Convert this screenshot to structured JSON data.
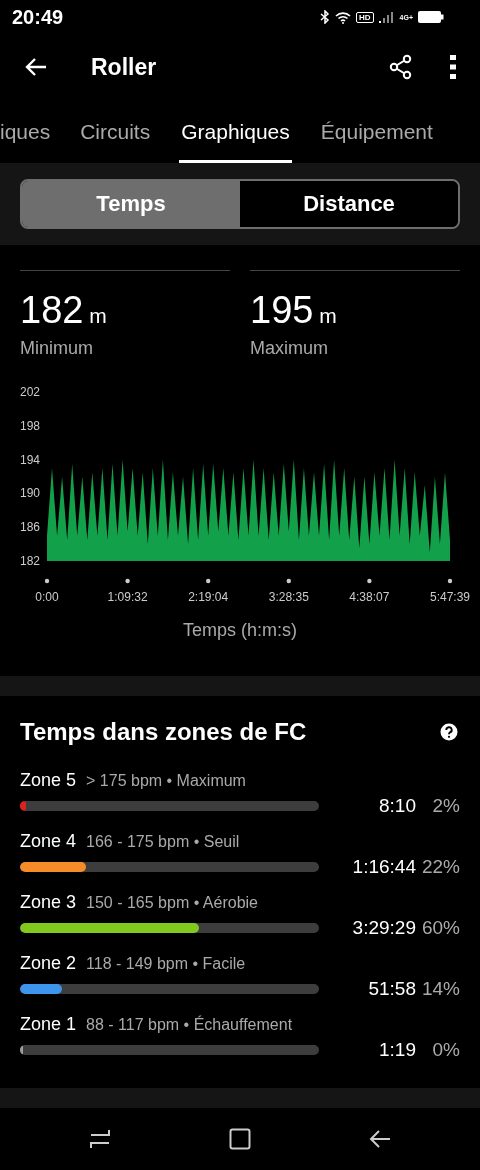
{
  "status_bar": {
    "time": "20:49",
    "hd": "HD",
    "network": "4G+"
  },
  "app_bar": {
    "title": "Roller"
  },
  "tabs": [
    {
      "label": "iques",
      "selected": false
    },
    {
      "label": "Circuits",
      "selected": false
    },
    {
      "label": "Graphiques",
      "selected": true
    },
    {
      "label": "Équipement",
      "selected": false
    }
  ],
  "segmented": [
    {
      "label": "Temps",
      "selected": true
    },
    {
      "label": "Distance",
      "selected": false
    }
  ],
  "stats": [
    {
      "value": "182",
      "unit": "m",
      "label": "Minimum"
    },
    {
      "value": "195",
      "unit": "m",
      "label": "Maximum"
    }
  ],
  "chart": {
    "chart_data": {
      "type": "area",
      "xlabel": "Temps (h:m:s)",
      "x": [
        0,
        261,
        521,
        782,
        1043,
        1304,
        1564,
        1825,
        2086,
        2347,
        2607,
        2868,
        3129,
        3390,
        3650,
        3911,
        4172,
        4433,
        4693,
        4954,
        5215,
        5476,
        5736,
        5997,
        6258,
        6519,
        6779,
        7040,
        7301,
        7561,
        7822,
        8083,
        8344,
        8604,
        8865,
        9126,
        9387,
        9647,
        9908,
        10169,
        10430,
        10690,
        10951,
        11212,
        11473,
        11733,
        11994,
        12255,
        12516,
        12776,
        13037,
        13298,
        13558,
        13819,
        14080,
        14341,
        14601,
        14862,
        15123,
        15384,
        15644,
        15905,
        16166,
        16427,
        16687,
        16948,
        17209,
        17470,
        17730,
        17991,
        18252,
        18513,
        18773,
        19034,
        19295,
        19556,
        19816,
        20077,
        20338,
        20598,
        20859
      ],
      "xlim": [
        0,
        20859
      ],
      "ylim": [
        182,
        202
      ],
      "yticks": [
        182,
        186,
        190,
        194,
        198,
        202
      ],
      "xticks": [
        {
          "value": 0,
          "label": "0:00"
        },
        {
          "value": 4172,
          "label": "1:09:32"
        },
        {
          "value": 8344,
          "label": "2:19:04"
        },
        {
          "value": 12515,
          "label": "3:28:35"
        },
        {
          "value": 16687,
          "label": "4:38:07"
        },
        {
          "value": 20859,
          "label": "5:47:39"
        }
      ],
      "series": [
        {
          "color": "#12a04a",
          "values": [
            185,
            193,
            185,
            192,
            184.5,
            193.5,
            185,
            192,
            184.5,
            192.5,
            185,
            193,
            184.5,
            193.5,
            185,
            194,
            185.5,
            193,
            185,
            192.5,
            184,
            193,
            185,
            194,
            184.5,
            192.5,
            185,
            192,
            184,
            193,
            184.5,
            193.5,
            185,
            193.5,
            185.5,
            193,
            185,
            192.5,
            184.5,
            193,
            185,
            194,
            185,
            193,
            184.5,
            192.5,
            185,
            193.5,
            185.5,
            194,
            184.5,
            193,
            185,
            192.5,
            185,
            193.5,
            184.5,
            194,
            185,
            193,
            184.5,
            192,
            183.5,
            192,
            184,
            192.5,
            185,
            193,
            184.5,
            194,
            185,
            193,
            184,
            192.5,
            185,
            191,
            183,
            192,
            184,
            192.5,
            184.5
          ]
        }
      ]
    }
  },
  "zones": {
    "title": "Temps dans zones de FC",
    "items": [
      {
        "name": "Zone 5",
        "range": "> 175 bpm • Maximum",
        "level": 0.02,
        "color": "#e0201c",
        "time": "8:10",
        "percent": "2%"
      },
      {
        "name": "Zone 4",
        "range": "166 - 175 bpm • Seuil",
        "level": 0.22,
        "color": "#f78b28",
        "time": "1:16:44",
        "percent": "22%"
      },
      {
        "name": "Zone 3",
        "range": "150 - 165 bpm • Aérobie",
        "level": 0.6,
        "color": "#82c91e",
        "time": "3:29:29",
        "percent": "60%"
      },
      {
        "name": "Zone 2",
        "range": "118 - 149 bpm • Facile",
        "level": 0.14,
        "color": "#3d95ee",
        "time": "51:58",
        "percent": "14%"
      },
      {
        "name": "Zone 1",
        "range": "88 - 117 bpm • Échauffement",
        "level": 0,
        "color": "#9e9e9e",
        "time": "1:19",
        "percent": "0%"
      }
    ]
  }
}
